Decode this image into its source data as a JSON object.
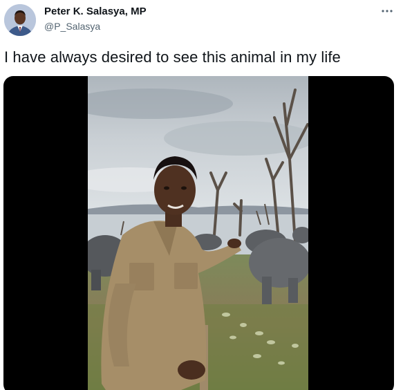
{
  "author": {
    "name": "Peter K. Salasya, MP",
    "handle": "@P_Salasya"
  },
  "tweet": {
    "text": "I have always desired to see this animal in my life"
  },
  "icons": {
    "more": "more-horizontal-icon",
    "avatar": "profile-photo"
  },
  "colors": {
    "text_primary": "#0f1419",
    "text_secondary": "#536471",
    "media_background": "#000000"
  }
}
